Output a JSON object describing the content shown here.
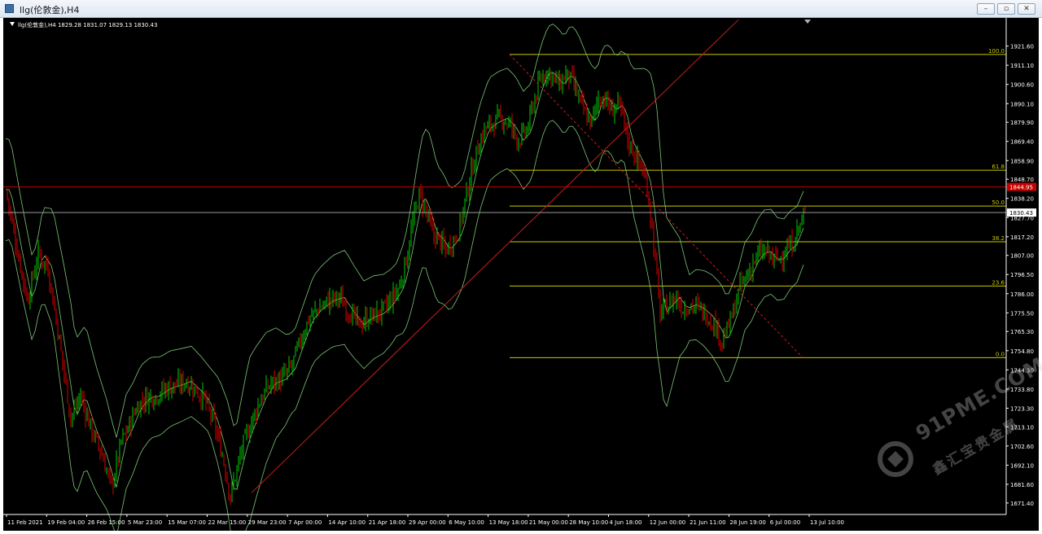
{
  "window": {
    "title": "llg(伦敦金),H4",
    "minimize_glyph": "–",
    "maximize_glyph": "▫",
    "close_glyph": "✕"
  },
  "symbol_header": "llg(伦敦金),H4  1829.28 1831.07 1829.13 1830.43",
  "watermark": {
    "text": "91PME.COM",
    "subtext": "鑫汇宝贵金属",
    "icon": "watermark-logo-icon"
  },
  "colors": {
    "background": "#000000",
    "bull": "#00c800",
    "bear": "#e00000",
    "bollinger": "#7cc576",
    "fib": "#c8c800",
    "trendline": "#c81e1e",
    "resistance_line": "#c80000",
    "bid_line": "#9a9a9a",
    "axis_text": "#ffffff"
  },
  "chart_data": {
    "type": "candlestick",
    "symbol": "llg(伦敦金)",
    "timeframe": "H4",
    "ohlc_current": {
      "open": 1829.28,
      "high": 1831.07,
      "low": 1829.13,
      "close": 1830.43
    },
    "ylim": [
      1666.0,
      1929.0
    ],
    "y_ticks": [
      "1921.60",
      "1911.10",
      "1900.60",
      "1890.10",
      "1879.90",
      "1869.40",
      "1858.90",
      "1848.70",
      "1838.20",
      "1827.70",
      "1817.20",
      "1807.00",
      "1796.50",
      "1786.00",
      "1775.50",
      "1765.30",
      "1754.80",
      "1744.30",
      "1733.80",
      "1723.30",
      "1713.10",
      "1702.60",
      "1692.10",
      "1681.60",
      "1671.40"
    ],
    "x_ticks": [
      "11 Feb 2021",
      "19 Feb 04:00",
      "26 Feb 15:00",
      "5 Mar 23:00",
      "15 Mar 07:00",
      "22 Mar 15:00",
      "29 Mar 23:00",
      "7 Apr 00:00",
      "14 Apr 10:00",
      "21 Apr 18:00",
      "29 Apr 00:00",
      "6 May 10:00",
      "13 May 18:00",
      "21 May 00:00",
      "28 May 10:00",
      "4 Jun 18:00",
      "12 Jun 00:00",
      "21 Jun 11:00",
      "28 Jun 19:00",
      "6 Jul 00:00",
      "13 Jul 10:00"
    ],
    "close_path": [
      [
        0,
        1843
      ],
      [
        14,
        1810
      ],
      [
        27,
        1782
      ],
      [
        40,
        1808
      ],
      [
        52,
        1800
      ],
      [
        66,
        1760
      ],
      [
        80,
        1718
      ],
      [
        92,
        1730
      ],
      [
        105,
        1712
      ],
      [
        118,
        1698
      ],
      [
        130,
        1680
      ],
      [
        142,
        1705
      ],
      [
        150,
        1712
      ],
      [
        160,
        1723
      ],
      [
        172,
        1729
      ],
      [
        184,
        1730
      ],
      [
        196,
        1734
      ],
      [
        210,
        1736
      ],
      [
        222,
        1738
      ],
      [
        234,
        1733
      ],
      [
        244,
        1728
      ],
      [
        256,
        1715
      ],
      [
        266,
        1698
      ],
      [
        276,
        1675
      ],
      [
        284,
        1690
      ],
      [
        292,
        1704
      ],
      [
        302,
        1716
      ],
      [
        314,
        1729
      ],
      [
        326,
        1737
      ],
      [
        338,
        1739
      ],
      [
        350,
        1745
      ],
      [
        362,
        1760
      ],
      [
        372,
        1772
      ],
      [
        382,
        1777
      ],
      [
        396,
        1782
      ],
      [
        410,
        1784
      ],
      [
        422,
        1776
      ],
      [
        434,
        1769
      ],
      [
        446,
        1773
      ],
      [
        458,
        1775
      ],
      [
        468,
        1779
      ],
      [
        476,
        1784
      ],
      [
        484,
        1790
      ],
      [
        492,
        1805
      ],
      [
        500,
        1825
      ],
      [
        508,
        1840
      ],
      [
        516,
        1832
      ],
      [
        524,
        1819
      ],
      [
        532,
        1816
      ],
      [
        540,
        1810
      ],
      [
        548,
        1814
      ],
      [
        556,
        1820
      ],
      [
        566,
        1840
      ],
      [
        576,
        1860
      ],
      [
        588,
        1876
      ],
      [
        600,
        1880
      ],
      [
        610,
        1882
      ],
      [
        620,
        1878
      ],
      [
        630,
        1870
      ],
      [
        640,
        1875
      ],
      [
        648,
        1890
      ],
      [
        656,
        1902
      ],
      [
        664,
        1908
      ],
      [
        672,
        1905
      ],
      [
        680,
        1900
      ],
      [
        688,
        1906
      ],
      [
        696,
        1902
      ],
      [
        704,
        1893
      ],
      [
        712,
        1884
      ],
      [
        720,
        1880
      ],
      [
        728,
        1893
      ],
      [
        736,
        1893
      ],
      [
        744,
        1886
      ],
      [
        752,
        1890
      ],
      [
        758,
        1883
      ],
      [
        764,
        1870
      ],
      [
        772,
        1863
      ],
      [
        780,
        1856
      ],
      [
        788,
        1845
      ],
      [
        796,
        1813
      ],
      [
        804,
        1775
      ],
      [
        812,
        1779
      ],
      [
        822,
        1784
      ],
      [
        832,
        1778
      ],
      [
        842,
        1780
      ],
      [
        852,
        1778
      ],
      [
        862,
        1774
      ],
      [
        872,
        1768
      ],
      [
        880,
        1760
      ],
      [
        886,
        1766
      ],
      [
        894,
        1776
      ],
      [
        902,
        1790
      ],
      [
        910,
        1795
      ],
      [
        918,
        1803
      ],
      [
        926,
        1808
      ],
      [
        934,
        1809
      ],
      [
        942,
        1805
      ],
      [
        950,
        1805
      ],
      [
        958,
        1810
      ],
      [
        966,
        1813
      ],
      [
        974,
        1822
      ],
      [
        982,
        1830.43
      ]
    ],
    "bollinger_bands": {
      "period_label": "",
      "middle_offset": 0,
      "band_width_points": [
        [
          0,
          28
        ],
        [
          40,
          22
        ],
        [
          80,
          45
        ],
        [
          130,
          28
        ],
        [
          180,
          22
        ],
        [
          250,
          18
        ],
        [
          300,
          45
        ],
        [
          350,
          22
        ],
        [
          420,
          26
        ],
        [
          480,
          20
        ],
        [
          520,
          40
        ],
        [
          560,
          30
        ],
        [
          600,
          28
        ],
        [
          660,
          26
        ],
        [
          720,
          28
        ],
        [
          760,
          30
        ],
        [
          800,
          66
        ],
        [
          840,
          18
        ],
        [
          880,
          24
        ],
        [
          930,
          24
        ],
        [
          982,
          20
        ]
      ]
    },
    "fibonacci": {
      "high": 1917.0,
      "low": 1751.0,
      "levels": [
        {
          "label": "100.0",
          "ratio": 1.0
        },
        {
          "label": "61.8",
          "ratio": 0.618
        },
        {
          "label": "50.0",
          "ratio": 0.5
        },
        {
          "label": "38.2",
          "ratio": 0.382
        },
        {
          "label": "23.6",
          "ratio": 0.236
        },
        {
          "label": "0.0",
          "ratio": 0.0
        }
      ],
      "x_start_bar": 622,
      "x_end_bar": 1232
    },
    "trendline": {
      "from": {
        "bar": 302,
        "price": 1677
      },
      "to": {
        "bar": 900,
        "price": 1936
      }
    },
    "fib_diagonal": {
      "from": {
        "bar": 622,
        "price": 1917
      },
      "to": {
        "bar": 982,
        "price": 1751
      }
    },
    "resistance_line": {
      "price": 1844.5,
      "label": "1844.95"
    },
    "bid_line": {
      "price": 1830.43,
      "label": "1830.43"
    },
    "grid": false
  }
}
